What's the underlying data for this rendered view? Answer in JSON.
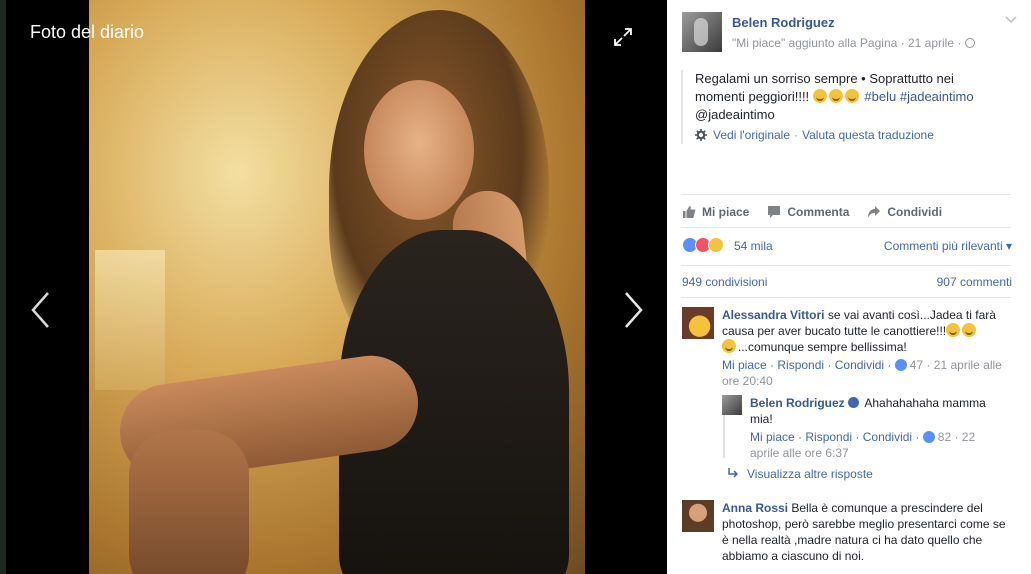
{
  "viewer": {
    "title": "Foto del diario"
  },
  "post": {
    "author": "Belen Rodriguez",
    "subtitle": "\"Mi piace\" aggiunto alla Pagina · 21 aprile ·",
    "text_line1": "Regalami un sorriso sempre • Soprattutto nei",
    "text_line2": "momenti peggiori!!!!",
    "hashtag1": "#belu",
    "hashtag2": "#jadeaintimo",
    "mention": "@jadeaintimo",
    "see_original": "Vedi l'originale",
    "translate": "Valuta questa traduzione"
  },
  "actions": {
    "like": "Mi piace",
    "comment": "Commenta",
    "share": "Condividi"
  },
  "reactions": {
    "count": "54 mila",
    "sort": "Commenti più rilevanti",
    "shares": "949 condivisioni",
    "comments": "907 commenti"
  },
  "comments": [
    {
      "name": "Alessandra Vittori",
      "text": " se vai avanti così...Jadea ti farà causa per aver bucato tutte le canottiere!!!",
      "text2": "...comunque sempre bellissima!",
      "like": "Mi piace",
      "reply": "Rispondi",
      "share": "Condividi",
      "likes": "47",
      "time": "21 aprile alle ore 20:40"
    },
    {
      "name": "Belen Rodriguez",
      "text": "Ahahahahaha mamma mia!",
      "like": "Mi piace",
      "reply": "Rispondi",
      "share": "Condividi",
      "likes": "82",
      "time": "22 aprile alle ore 6:37"
    },
    {
      "name": "Anna Rossi",
      "text": " Bella è comunque a prescindere del photoshop, però sarebbe meglio presentarci come se è nella realtà ,madre natura ci ha dato quello che abbiamo a ciascuno di noi."
    }
  ],
  "more_replies": "Visualizza altre risposte",
  "colors": {
    "link": "#4267b2",
    "name": "#365899",
    "meta": "#90949c"
  }
}
